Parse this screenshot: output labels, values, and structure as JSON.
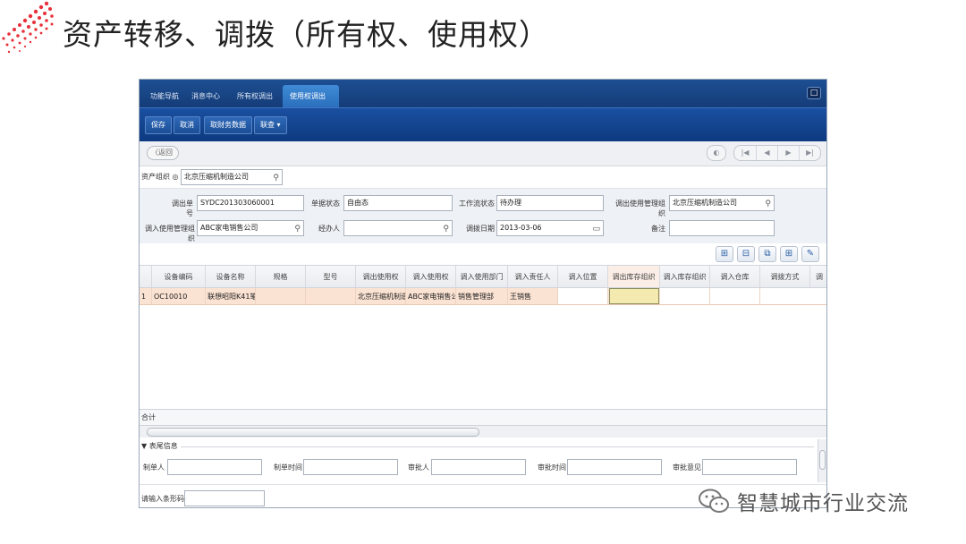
{
  "slide": {
    "title": "资产转移、调拨（所有权、使用权）",
    "watermark": "智慧城市行业交流"
  },
  "app": {
    "tabs": [
      {
        "label": "功能导航"
      },
      {
        "label": "消息中心"
      },
      {
        "label": "所有权调出"
      },
      {
        "label": "使用权调出"
      }
    ],
    "window_button": "□",
    "toolbar": {
      "save": "保存",
      "cancel": "取消",
      "fetch_data": "取财务数据",
      "associate": "联查 ▾"
    },
    "nav": {
      "back": "〈返回",
      "pager_extra": "◐",
      "pager": [
        "|◀",
        "◀",
        "▶",
        "▶|"
      ]
    },
    "org": {
      "label": "资产组织 ◎",
      "value": "北京压缩机制造公司"
    },
    "form": {
      "out_no_label": "调出单号",
      "out_no_value": "SYDC201303060001",
      "doc_status_label": "单据状态",
      "doc_status_value": "自由态",
      "workflow_label": "工作流状态",
      "workflow_value": "待办理",
      "out_org_label": "调出使用管理组织",
      "out_org_value": "北京压缩机制造公司",
      "in_org_label": "调入使用管理组织",
      "in_org_value": "ABC家电销售公司",
      "handler_label": "经办人",
      "handler_value": "",
      "date_label": "调拨日期",
      "date_value": "2013-03-06",
      "remark_label": "备注",
      "remark_value": ""
    },
    "grid_tools": [
      "⊞",
      "⊟",
      "⧉",
      "⊞",
      "✎"
    ],
    "grid": {
      "columns": [
        "",
        "设备编码",
        "设备名称",
        "规格",
        "型号",
        "调出使用权",
        "调入使用权",
        "调入使用部门",
        "调入责任人",
        "调入位置",
        "调出库存组织",
        "调入库存组织",
        "调入仓库",
        "调拨方式",
        "调"
      ],
      "row": {
        "num": "1",
        "code": "OC10010",
        "name": "联想昭阳K41笔...",
        "spec": "",
        "model": "",
        "out_right": "北京压缩机制造...",
        "in_right": "ABC家电销售公...",
        "in_dept": "销售管理部",
        "in_person": "王销售",
        "in_location": "",
        "out_stock_org": "",
        "in_stock_org": "",
        "in_warehouse": "",
        "method": ""
      },
      "sum_label": "合计"
    },
    "footer": {
      "section_title": "▼ 表尾信息",
      "creator_label": "制单人",
      "create_time_label": "制单时间",
      "approver_label": "审批人",
      "approve_time_label": "审批时间",
      "approve_opinion_label": "审批意见",
      "barcode_label": "请输入条形码"
    }
  },
  "colors": {
    "tabbar": "#1d4f93",
    "toolbar": "#0d3a80",
    "selected_row": "#fbe3d3",
    "selected_cell": "#f4eab0"
  }
}
